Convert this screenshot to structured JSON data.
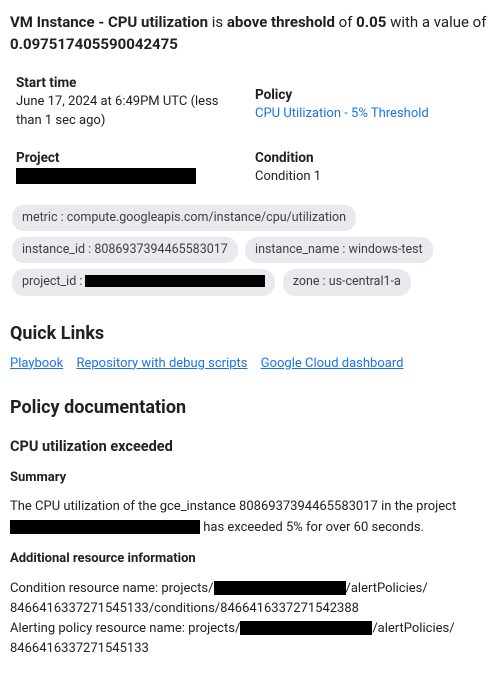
{
  "title": {
    "p1_bold": "VM Instance - CPU utilization",
    "p2": " is ",
    "p3_bold": "above threshold",
    "p4": " of ",
    "p5_bold": "0.05",
    "p6": " with a value of ",
    "p7_bold": "0.097517405590042475"
  },
  "meta": {
    "start_time_label": "Start time",
    "start_time_value": "June 17, 2024 at 6:49PM UTC (less than 1 sec ago)",
    "policy_label": "Policy",
    "policy_value": "CPU Utilization - 5% Threshold",
    "project_label": "Project",
    "condition_label": "Condition",
    "condition_value": "Condition 1"
  },
  "chips": {
    "metric": "metric : compute.googleapis.com/instance/cpu/utilization",
    "instance_id": "instance_id : 8086937394465583017",
    "instance_name": "instance_name : windows-test",
    "project_id_prefix": "project_id : ",
    "zone": "zone : us-central1-a"
  },
  "quicklinks": {
    "heading": "Quick Links",
    "playbook": "Playbook",
    "repo": "Repository with debug scripts",
    "dashboard": "Google Cloud dashboard"
  },
  "doc": {
    "heading": "Policy documentation",
    "sub1": "CPU utilization exceeded",
    "summary_label": "Summary",
    "summary_p1": "The CPU utilization of the gce_instance 8086937394465583017 in the project ",
    "summary_p2": " has exceeded 5% for over 60 seconds.",
    "addl_label": "Additional resource information",
    "cond_p1": "Condition resource name: projects/",
    "cond_p2": "/alertPolicies/",
    "cond_p3": "8466416337271545133/conditions/8466416337271542388",
    "pol_p1": "Alerting policy resource name: projects/",
    "pol_p2": "/alertPolicies/",
    "pol_p3": "8466416337271545133"
  }
}
